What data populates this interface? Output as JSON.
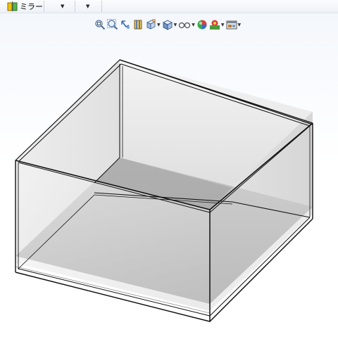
{
  "toolbar": {
    "mirror_label": "ミラー",
    "dropdown_arrow": "▼"
  },
  "view_toolbar": {
    "icons": [
      "zoom-to-fit-icon",
      "zoom-to-area-icon",
      "previous-view-icon",
      "section-view-icon",
      "view-orientation-icon",
      "display-style-icon",
      "hide-show-items-icon",
      "edit-appearance-icon",
      "apply-scene-icon",
      "view-settings-icon"
    ]
  },
  "colors": {
    "viewport_top": "#f4f7fc",
    "edge": "#111111",
    "face_dark": "#9a9a9a",
    "face_light": "#e6e6e6"
  }
}
